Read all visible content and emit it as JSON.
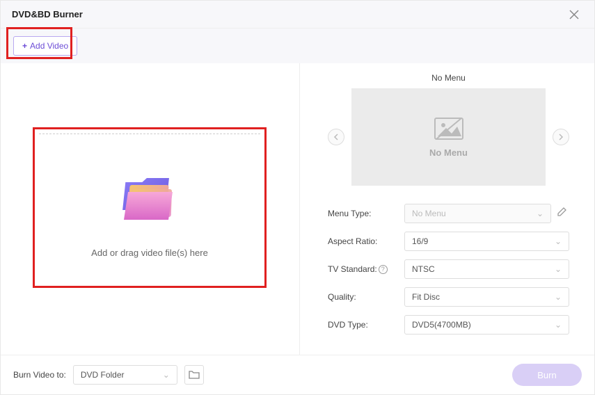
{
  "window": {
    "title": "DVD&BD Burner"
  },
  "toolbar": {
    "add_video_label": "Add Video"
  },
  "drop": {
    "text": "Add or drag video file(s) here"
  },
  "preview": {
    "title": "No Menu",
    "placeholder": "No Menu"
  },
  "settings": {
    "menu_type": {
      "label": "Menu Type:",
      "value": "No Menu"
    },
    "aspect_ratio": {
      "label": "Aspect Ratio:",
      "value": "16/9"
    },
    "tv_standard": {
      "label": "TV Standard:",
      "value": "NTSC"
    },
    "quality": {
      "label": "Quality:",
      "value": "Fit Disc"
    },
    "dvd_type": {
      "label": "DVD Type:",
      "value": "DVD5(4700MB)"
    }
  },
  "footer": {
    "burn_to_label": "Burn Video to:",
    "burn_to_value": "DVD Folder",
    "burn_button": "Burn"
  }
}
